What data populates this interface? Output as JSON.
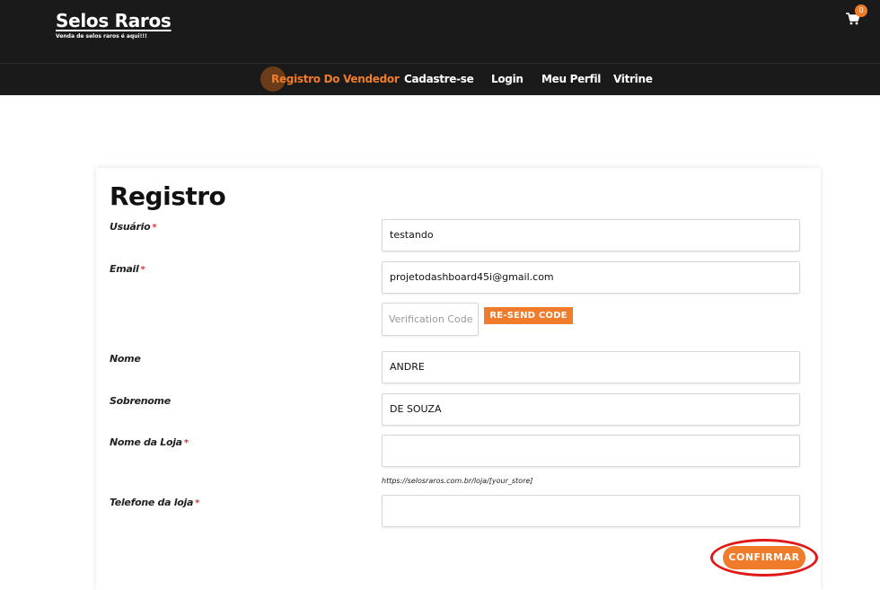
{
  "header": {
    "brand_title": "Selos Raros",
    "brand_subtitle": "Venda de selos raros é aqui!!!",
    "cart_count": "0",
    "accent_color": "#f07b2a",
    "bar_color": "#1a1a1a"
  },
  "nav": {
    "items": [
      {
        "label": "Registro Do Vendedor",
        "active": true
      },
      {
        "label": "Cadastre-se",
        "active": false
      },
      {
        "label": "Login",
        "active": false
      },
      {
        "label": "Meu Perfil",
        "active": false
      },
      {
        "label": "Vitrine",
        "active": false
      }
    ]
  },
  "form": {
    "title": "Registro",
    "fields": {
      "usuario": {
        "label": "Usuário",
        "required": "*",
        "value": "testando"
      },
      "email": {
        "label": "Email",
        "required": "*",
        "value": "projetodashboard45i@gmail.com"
      },
      "verification": {
        "placeholder": "Verification Code",
        "resend_label": "RE-SEND CODE"
      },
      "nome": {
        "label": "Nome",
        "value": "ANDRE"
      },
      "sobrenome": {
        "label": "Sobrenome",
        "value": "DE SOUZA"
      },
      "loja": {
        "label": "Nome da Loja",
        "required": "*",
        "value": "",
        "hint": "https://selosraros.com.br/loja/[your_store]"
      },
      "telefone": {
        "label": "Telefone da loja",
        "required": "*",
        "value": ""
      }
    },
    "submit_label": "CONFIRMAR"
  },
  "icons": {
    "cart": "shopping-cart-icon"
  }
}
